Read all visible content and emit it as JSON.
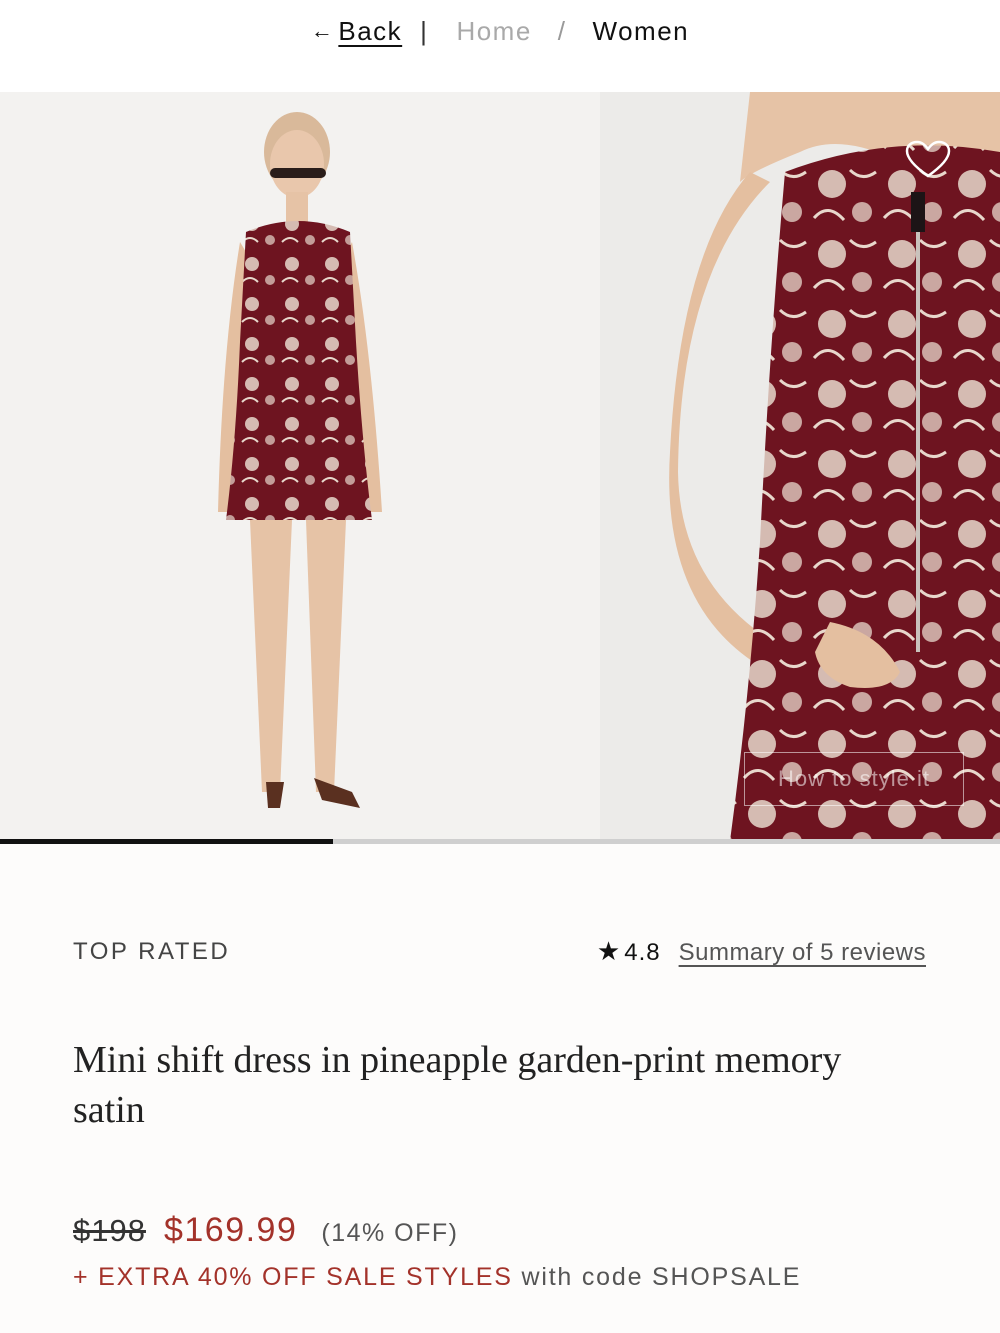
{
  "nav": {
    "back_arrow": "←",
    "back_label": "Back",
    "separator": "|",
    "home_label": "Home",
    "slash": "/",
    "women_label": "Women"
  },
  "gallery": {
    "how_to_label": "How to style it",
    "progress_fraction": 0.333
  },
  "product": {
    "badge": "TOP RATED",
    "star": "★",
    "rating": "4.8",
    "reviews_link": "Summary of 5 reviews",
    "title": "Mini shift dress in pineapple garden-print memory satin",
    "old_price": "$198",
    "sale_price": "$169.99",
    "discount": "(14% OFF)",
    "promo_highlight": "+ EXTRA 40% OFF SALE STYLES",
    "promo_rest": " with code SHOPSALE"
  },
  "colors": {
    "accent_red": "#a3322a",
    "dress_burgundy": "#6e1420",
    "print_cream": "#e8d8cc"
  },
  "icons": [
    "back-arrow-icon",
    "heart-icon",
    "star-icon"
  ]
}
